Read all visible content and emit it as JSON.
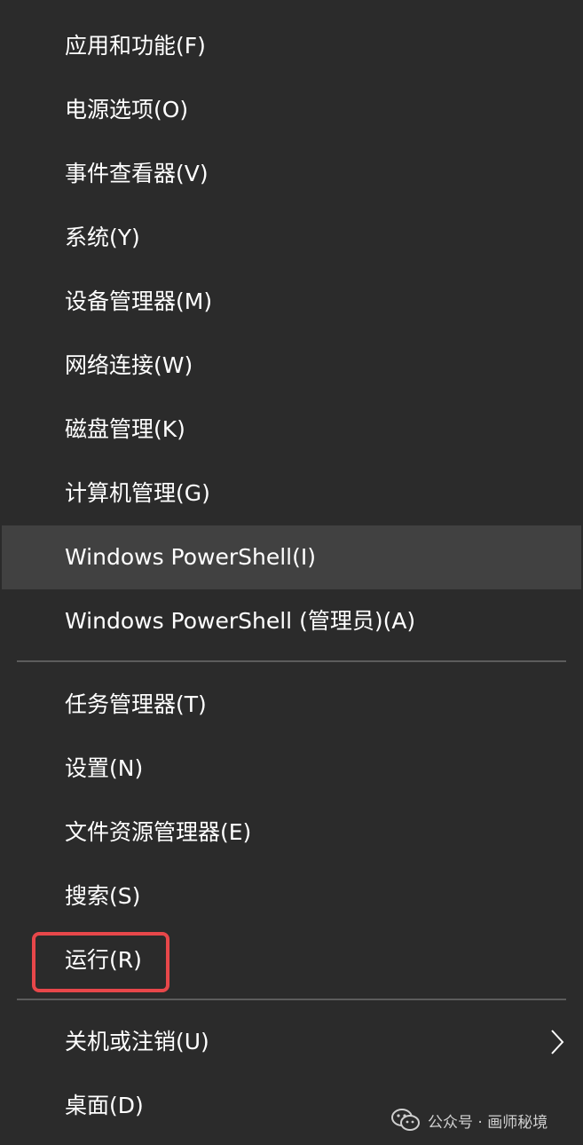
{
  "menu": {
    "items": [
      {
        "label": "应用和功能(F)"
      },
      {
        "label": "电源选项(O)"
      },
      {
        "label": "事件查看器(V)"
      },
      {
        "label": "系统(Y)"
      },
      {
        "label": "设备管理器(M)"
      },
      {
        "label": "网络连接(W)"
      },
      {
        "label": "磁盘管理(K)"
      },
      {
        "label": "计算机管理(G)"
      },
      {
        "label": "Windows PowerShell(I)",
        "state": "hover"
      },
      {
        "label": "Windows PowerShell (管理员)(A)"
      },
      {
        "label": "任务管理器(T)"
      },
      {
        "label": "设置(N)"
      },
      {
        "label": "文件资源管理器(E)"
      },
      {
        "label": "搜索(S)"
      },
      {
        "label": "运行(R)",
        "state": "highlighted"
      },
      {
        "label": "关机或注销(U)",
        "submenu_icon": "chevron-right-icon"
      },
      {
        "label": "桌面(D)"
      }
    ]
  },
  "watermark": {
    "text": "公众号 · 画师秘境",
    "icon": "wechat-icon"
  },
  "colors": {
    "background": "#2b2b2b",
    "hover": "#414141",
    "separator": "#5c5c5c",
    "highlight_border": "#e8474a",
    "text": "#ffffff"
  }
}
